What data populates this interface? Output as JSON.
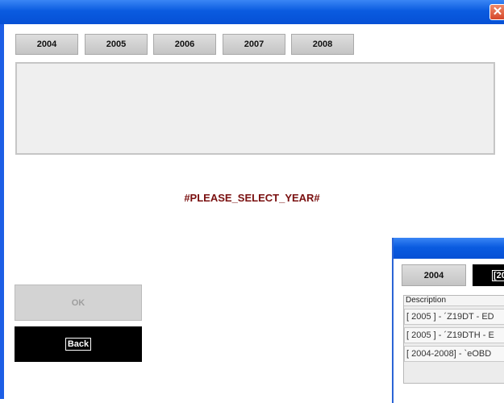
{
  "window": {
    "close_glyph": "✕"
  },
  "years": [
    "2004",
    "2005",
    "2006",
    "2007",
    "2008"
  ],
  "prompt": "#PLEASE_SELECT_YEAR#",
  "buttons": {
    "ok": "OK",
    "back": "Back"
  },
  "second_window": {
    "year_buttons": [
      "2004",
      "[20"
    ],
    "table": {
      "header": "Description",
      "rows": [
        "[ 2005 ] - ´Z19DT - ED",
        "[ 2005 ] - ´Z19DTH - E",
        "[ 2004-2008] - `eOBD"
      ]
    }
  }
}
